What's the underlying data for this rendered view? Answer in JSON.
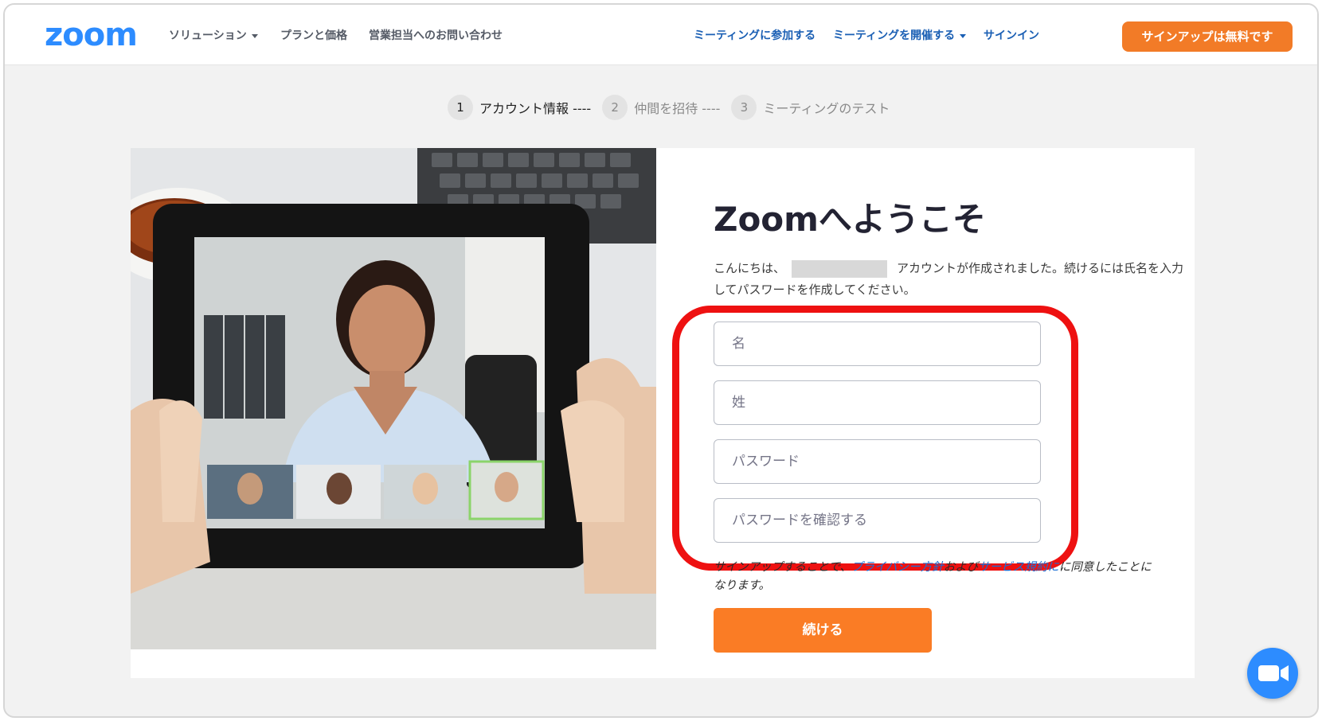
{
  "header": {
    "logo": "zoom",
    "nav_left": [
      {
        "label": "ソリューション",
        "dropdown": true
      },
      {
        "label": "プランと価格",
        "dropdown": false
      },
      {
        "label": "営業担当へのお問い合わせ",
        "dropdown": false
      }
    ],
    "nav_right": [
      {
        "label": "ミーティングに参加する",
        "dropdown": false
      },
      {
        "label": "ミーティングを開催する",
        "dropdown": true
      },
      {
        "label": "サインイン",
        "dropdown": false
      }
    ],
    "signup_label": "サインアップは無料です"
  },
  "stepper": [
    {
      "num": "1",
      "label": "アカウント情報 ----",
      "active": true
    },
    {
      "num": "2",
      "label": "仲間を招待 ----",
      "active": false
    },
    {
      "num": "3",
      "label": "ミーティングのテスト",
      "active": false
    }
  ],
  "form": {
    "title": "Zoomへようこそ",
    "intro_before": "こんにちは、",
    "intro_after": "アカウントが作成されました。続けるには氏名を入力してパスワードを作成してください。",
    "first_name_placeholder": "名",
    "last_name_placeholder": "姓",
    "password_placeholder": "パスワード",
    "confirm_password_placeholder": "パスワードを確認する",
    "terms_prefix": "サインアップすることで、",
    "privacy_link": "プライバシー方針",
    "terms_middle": "および",
    "service_link": "サービス規約に",
    "terms_suffix": "に同意したことになります。",
    "continue_label": "続ける"
  },
  "colors": {
    "brand_blue": "#2d8cff",
    "accent_orange": "#f27b27",
    "highlight_red": "#ee1111",
    "link_blue": "#1a6fd6"
  },
  "icons": {
    "chat_fab": "video-camera-icon"
  }
}
